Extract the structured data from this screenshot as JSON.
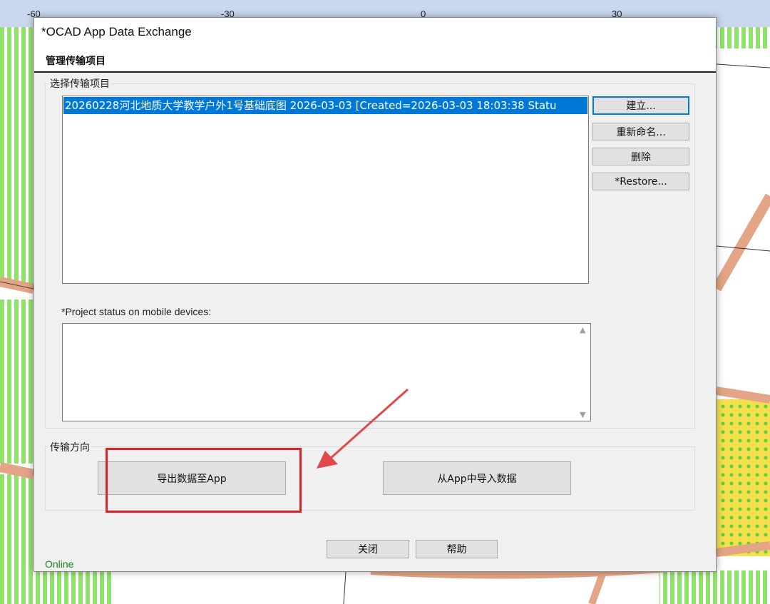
{
  "ruler": {
    "labels": [
      "-60",
      "-30",
      "0",
      "30"
    ]
  },
  "dialog": {
    "window_title": "*OCAD App Data Exchange",
    "page_header": "管理传输项目",
    "select_group_label": "选择传输项目",
    "projects": [
      {
        "text": "20260228河北地质大学教学户外1号基础底图 2026-03-03  [Created=2026-03-03 18:03:38 Statu",
        "selected": true
      }
    ],
    "buttons": {
      "create": "建立...",
      "rename": "重新命名...",
      "delete": "删除",
      "restore": "*Restore..."
    },
    "status_label": "*Project status on mobile devices:",
    "status_text": "",
    "direction_group_label": "传输方向",
    "export_button": "导出数据至App",
    "import_button": "从App中导入数据",
    "close_button": "关闭",
    "help_button": "帮助",
    "online_status": "Online"
  },
  "colors": {
    "selection": "#0078d7",
    "annotation": "#d6262c",
    "online": "#1a7f1a",
    "map_green": "#8fe36a",
    "map_road": "#e3a585",
    "map_yellow": "#f4e04d"
  }
}
